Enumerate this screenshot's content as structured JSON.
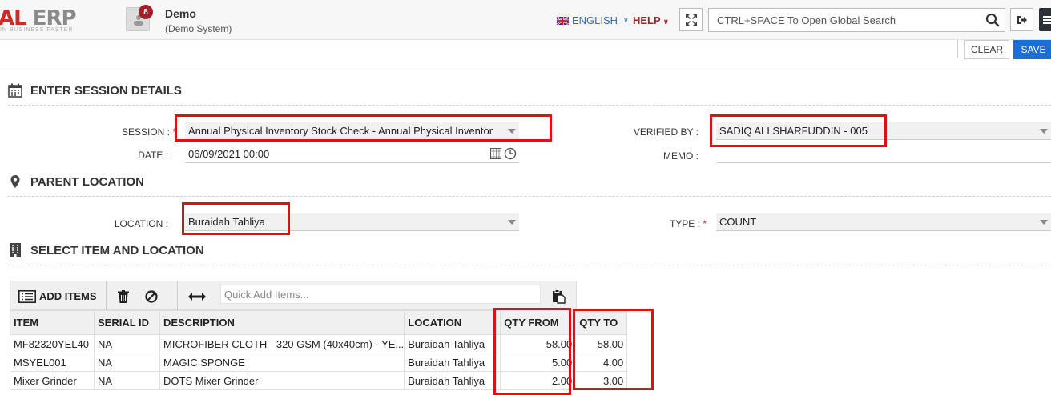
{
  "header": {
    "logo_main": "AL ",
    "logo_erp": "ERP",
    "logo_tagline": "IN BUSINESS FASTER",
    "notification_count": "8",
    "company_name": "Demo",
    "company_sub": "(Demo System)",
    "language": "ENGLISH",
    "help": "HELP",
    "search_placeholder": "CTRL+SPACE To Open Global Search"
  },
  "actions": {
    "clear": "CLEAR",
    "save": "SAVE"
  },
  "session_details": {
    "title": "ENTER SESSION DETAILS",
    "session_label": "SESSION :",
    "session_required": "*",
    "session_value": "Annual Physical Inventory Stock Check - Annual Physical Inventor",
    "date_label": "DATE :",
    "date_value": "06/09/2021 00:00",
    "verified_by_label": "VERIFIED BY :",
    "verified_by_value": "SADIQ ALI  SHARFUDDIN - 005",
    "memo_label": "MEMO :",
    "memo_value": ""
  },
  "parent_location": {
    "title": "PARENT LOCATION",
    "location_label": "LOCATION :",
    "location_value": "Buraidah Tahliya",
    "type_label": "TYPE :",
    "type_required": "*",
    "type_value": "COUNT"
  },
  "select_items": {
    "title": "SELECT ITEM AND LOCATION",
    "add_items": "ADD ITEMS",
    "quick_add_placeholder": "Quick Add Items..."
  },
  "grid": {
    "columns": [
      "ITEM",
      "SERIAL ID",
      "DESCRIPTION",
      "LOCATION",
      "QTY FROM",
      "QTY TO"
    ],
    "rows": [
      [
        "MF82320YEL40",
        "NA",
        "MICROFIBER CLOTH - 320 GSM (40x40cm) - YE...",
        "Buraidah Tahliya",
        "58.00",
        "58.00"
      ],
      [
        "MSYEL001",
        "NA",
        "MAGIC SPONGE",
        "Buraidah Tahliya",
        "5.00",
        "4.00"
      ],
      [
        "Mixer Grinder",
        "NA",
        "DOTS Mixer Grinder",
        "Buraidah Tahliya",
        "2.00",
        "3.00"
      ]
    ]
  },
  "colors": {
    "brand_red": "#cf2a2a",
    "accent_blue": "#1b6fd4",
    "highlight": "#e01010"
  }
}
